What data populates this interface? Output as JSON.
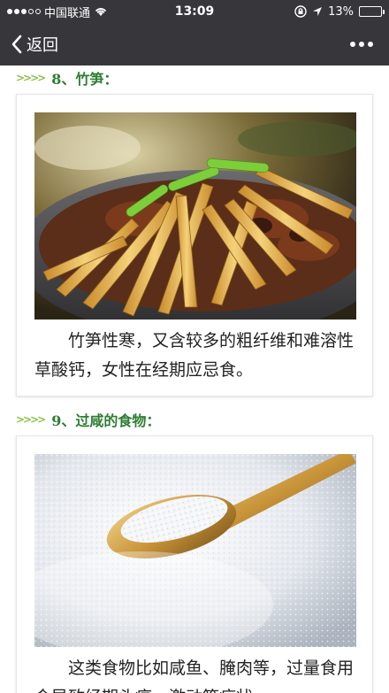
{
  "status_bar": {
    "carrier": "中国联通",
    "time": "13:09",
    "battery_text": "13%",
    "battery_level_percent": 13
  },
  "nav": {
    "back_label": "返回"
  },
  "sections": [
    {
      "heading": "8、竹笋：",
      "caption": "竹笋性寒，又含较多的粗纤维和难溶性草酸钙，女性在经期应忌食。"
    },
    {
      "heading": "9、过咸的食物：",
      "caption": "这类食物比如咸鱼、腌肉等，过量食用会导致经期头痛、激动等症状。"
    }
  ],
  "colors": {
    "bar_bg": "#37373b",
    "heading_green": "#2e7d32",
    "arrow_green": "#8bc34a",
    "battery_red": "#ff3b30"
  }
}
